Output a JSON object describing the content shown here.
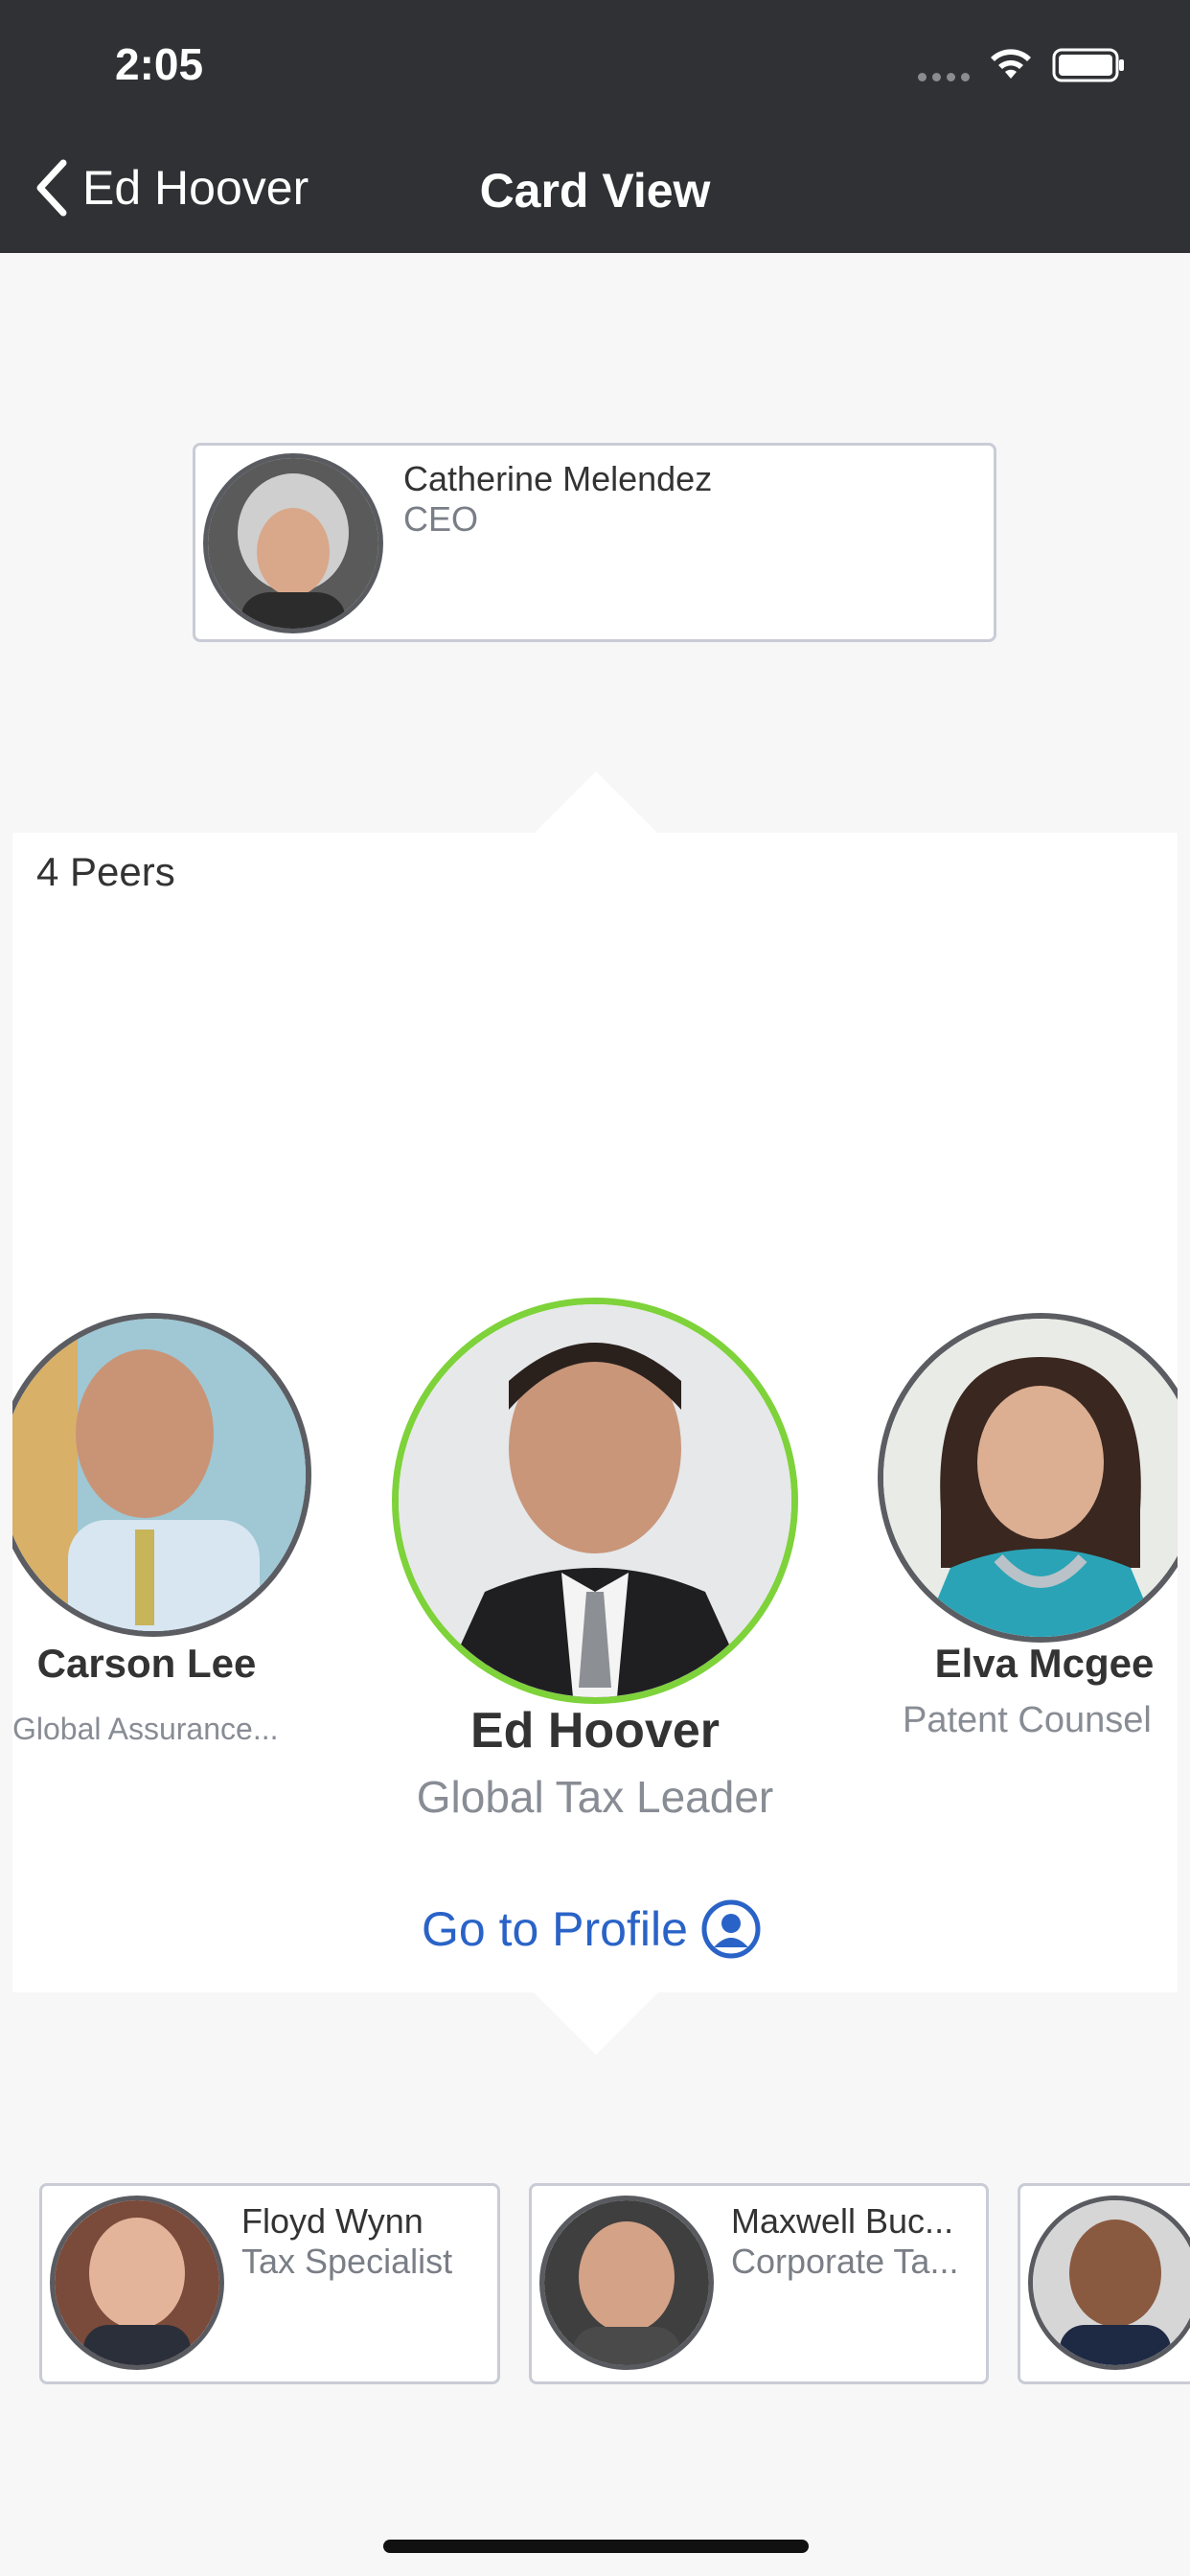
{
  "status": {
    "time": "2:05"
  },
  "nav": {
    "back_label": "Ed Hoover",
    "title": "Card View"
  },
  "manager": {
    "name": "Catherine Melendez",
    "role": "CEO"
  },
  "peers": {
    "count_label": "4 Peers",
    "left": {
      "name": "Carson Lee",
      "role": "Global Assurance..."
    },
    "center": {
      "name": "Ed Hoover",
      "role": "Global Tax Leader"
    },
    "right": {
      "name": "Elva Mcgee",
      "role": "Patent Counsel"
    }
  },
  "go_to_profile_label": "Go to Profile",
  "reports": [
    {
      "name": "Floyd Wynn",
      "role": "Tax Specialist"
    },
    {
      "name": "Maxwell Buc...",
      "role": "Corporate Ta..."
    },
    {
      "name": "",
      "role": ""
    }
  ],
  "colors": {
    "header_bg": "#2f3134",
    "accent_ring": "#7ed23a",
    "link": "#2a63c7",
    "card_border": "#c9ccd6"
  }
}
